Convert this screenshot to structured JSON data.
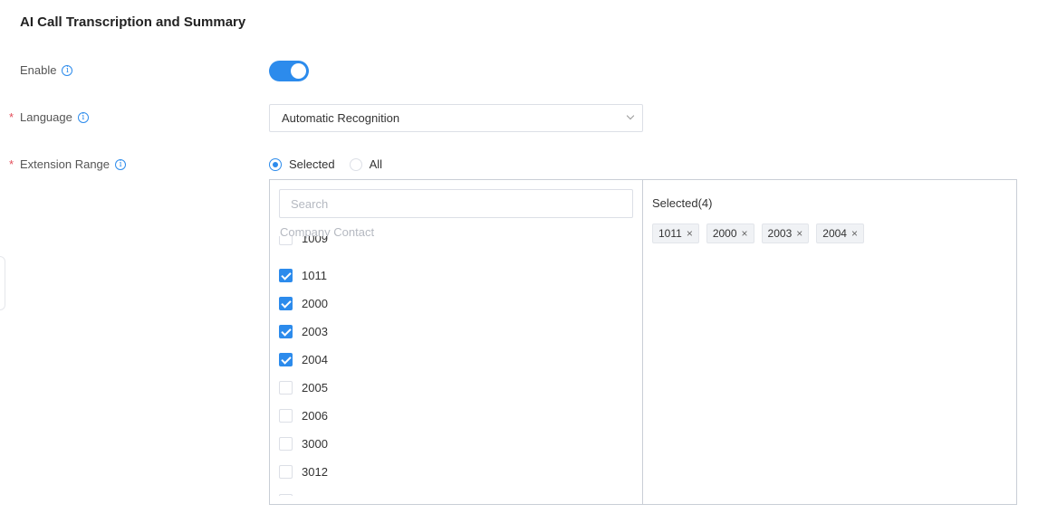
{
  "section": {
    "title": "AI Call Transcription and Summary"
  },
  "enable": {
    "label": "Enable",
    "info_icon": "i",
    "toggle_on": true
  },
  "language": {
    "required_mark": "*",
    "label": "Language",
    "info_icon": "i",
    "value": "Automatic Recognition"
  },
  "extension_range": {
    "required_mark": "*",
    "label": "Extension Range",
    "info_icon": "i",
    "options": [
      {
        "label": "Selected",
        "checked": true
      },
      {
        "label": "All",
        "checked": false
      }
    ]
  },
  "transfer": {
    "search_placeholder": "Search",
    "group_label": "Company Contact",
    "items": [
      {
        "label": "1009",
        "checked": false
      },
      {
        "label": "1011",
        "checked": true
      },
      {
        "label": "2000",
        "checked": true
      },
      {
        "label": "2003",
        "checked": true
      },
      {
        "label": "2004",
        "checked": true
      },
      {
        "label": "2005",
        "checked": false
      },
      {
        "label": "2006",
        "checked": false
      },
      {
        "label": "3000",
        "checked": false
      },
      {
        "label": "3012",
        "checked": false
      },
      {
        "label": "",
        "checked": false
      }
    ],
    "selected_title": "Selected(4)",
    "selected_tags": [
      "1011",
      "2000",
      "2003",
      "2004"
    ],
    "remove_glyph": "×"
  },
  "colors": {
    "accent": "#2c8bec",
    "required": "#e34d59",
    "border": "#c9ced6"
  }
}
